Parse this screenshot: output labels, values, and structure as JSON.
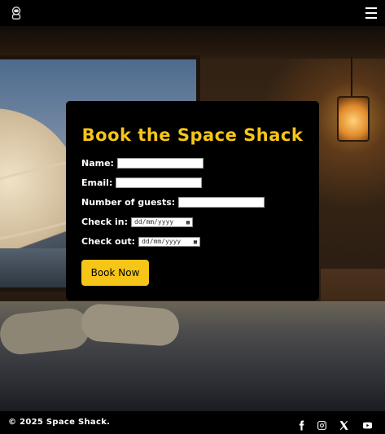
{
  "nav": {
    "logo_icon": "astronaut-logo-icon",
    "menu_icon": "hamburger-menu-icon"
  },
  "form": {
    "title": "Book the Space Shack",
    "name_label": "Name:",
    "email_label": "Email:",
    "guests_label": "Number of guests:",
    "checkin_label": "Check in:",
    "checkout_label": "Check out:",
    "checkin_placeholder": "dd/mm/yyyy",
    "checkout_placeholder": "dd/mm/yyyy",
    "submit_label": "Book Now"
  },
  "footer": {
    "copyright": "© 2025 Space Shack.",
    "social_icons": [
      "facebook-icon",
      "instagram-icon",
      "x-icon",
      "youtube-icon"
    ]
  },
  "colors": {
    "accent": "#f5c518",
    "card": "#000000",
    "text": "#ffffff"
  }
}
